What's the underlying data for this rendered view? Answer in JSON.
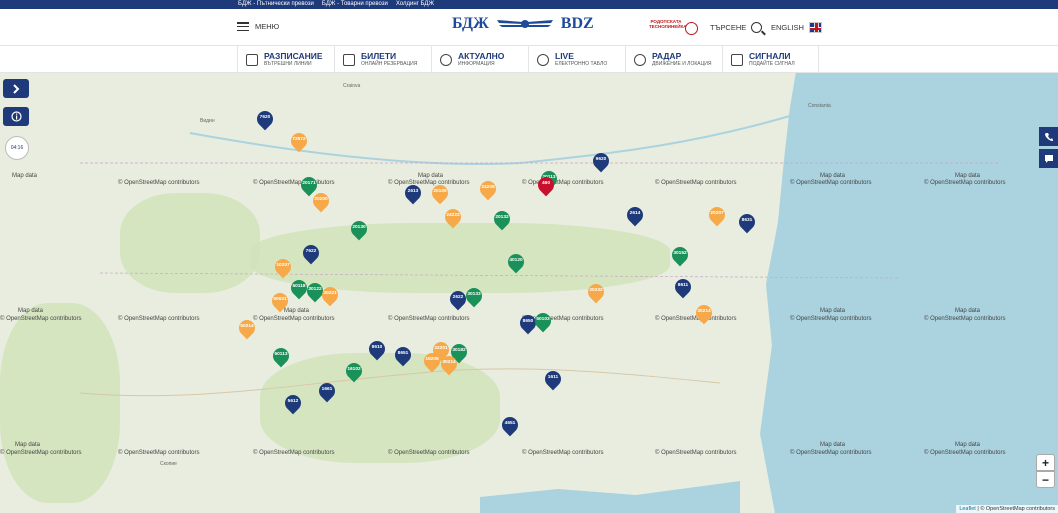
{
  "topbar": {
    "links": [
      "БДЖ - Пътнически превози",
      "БДЖ - Товарни превози",
      "Холдинг БДЖ"
    ]
  },
  "header": {
    "menu_label": "МЕНЮ",
    "logo_left": "БДЖ",
    "logo_right": "BDZ",
    "partner_text": "РОДОПСКАТА ТЕСНОЛИНЕЙКА",
    "search_label": "ТЪРСЕНЕ",
    "lang_label": "ENGLISH"
  },
  "nav": [
    {
      "title": "РАЗПИСАНИЕ",
      "sub": "ВЪТРЕШНИ ЛИНИИ",
      "icon": "calendar-icon"
    },
    {
      "title": "БИЛЕТИ",
      "sub": "ОНЛАЙН РЕЗЕРВАЦИЯ",
      "icon": "ticket-icon"
    },
    {
      "title": "АКТУАЛНО",
      "sub": "ИНФОРМАЦИЯ",
      "icon": "info-icon"
    },
    {
      "title": "LIVE",
      "sub": "ЕЛЕКТРОННО ТАБЛО",
      "icon": "clock-icon"
    },
    {
      "title": "РАДАР",
      "sub": "ДВИЖЕНИЕ И ЛОКАЦИЯ",
      "icon": "location-pin-icon"
    },
    {
      "title": "СИГНАЛИ",
      "sub": "ПОДАЙТЕ СИГНАЛ",
      "icon": "chat-icon"
    }
  ],
  "map": {
    "clock_text": "04:16",
    "tile_md": "Map data",
    "tile_attr": "© OpenStreetMap contributors",
    "zoom_in": "+",
    "zoom_out": "−",
    "leaflet_link": "Leaflet",
    "leaflet_attr": "© OpenStreetMap contributors",
    "cities": [
      "Craiova",
      "Constanta",
      "Скопие",
      "Видин"
    ],
    "marker_colors": {
      "blue": "#1f3a7a",
      "green": "#1a9158",
      "orange": "#f7a94a",
      "red": "#c8102e"
    },
    "trains": [
      {
        "id": "7620",
        "color": "blue"
      },
      {
        "id": "72572",
        "color": "orange"
      },
      {
        "id": "20171",
        "color": "green"
      },
      {
        "id": "20200",
        "color": "orange"
      },
      {
        "id": "2613",
        "color": "blue"
      },
      {
        "id": "20105",
        "color": "orange"
      },
      {
        "id": "24205",
        "color": "orange"
      },
      {
        "id": "20113",
        "color": "green"
      },
      {
        "id": "460",
        "color": "red"
      },
      {
        "id": "9620",
        "color": "blue"
      },
      {
        "id": "24223",
        "color": "orange"
      },
      {
        "id": "20132",
        "color": "green"
      },
      {
        "id": "2614",
        "color": "blue"
      },
      {
        "id": "20207",
        "color": "orange"
      },
      {
        "id": "8631",
        "color": "blue"
      },
      {
        "id": "20130",
        "color": "green"
      },
      {
        "id": "7622",
        "color": "blue"
      },
      {
        "id": "10207",
        "color": "orange"
      },
      {
        "id": "40120",
        "color": "green"
      },
      {
        "id": "30152",
        "color": "green"
      },
      {
        "id": "50118",
        "color": "green"
      },
      {
        "id": "30122",
        "color": "green"
      },
      {
        "id": "50021",
        "color": "orange"
      },
      {
        "id": "30221",
        "color": "orange"
      },
      {
        "id": "2622",
        "color": "blue"
      },
      {
        "id": "30133",
        "color": "green"
      },
      {
        "id": "20232",
        "color": "orange"
      },
      {
        "id": "8611",
        "color": "blue"
      },
      {
        "id": "50214",
        "color": "orange"
      },
      {
        "id": "8650",
        "color": "blue"
      },
      {
        "id": "50103",
        "color": "green"
      },
      {
        "id": "30214",
        "color": "orange"
      },
      {
        "id": "8610",
        "color": "blue"
      },
      {
        "id": "8651",
        "color": "blue"
      },
      {
        "id": "32201",
        "color": "orange"
      },
      {
        "id": "30182",
        "color": "green"
      },
      {
        "id": "50113",
        "color": "green"
      },
      {
        "id": "16102",
        "color": "green"
      },
      {
        "id": "19205",
        "color": "orange"
      },
      {
        "id": "30214",
        "color": "orange"
      },
      {
        "id": "1611",
        "color": "blue"
      },
      {
        "id": "1661",
        "color": "blue"
      },
      {
        "id": "5612",
        "color": "blue"
      },
      {
        "id": "4651",
        "color": "blue"
      }
    ]
  }
}
